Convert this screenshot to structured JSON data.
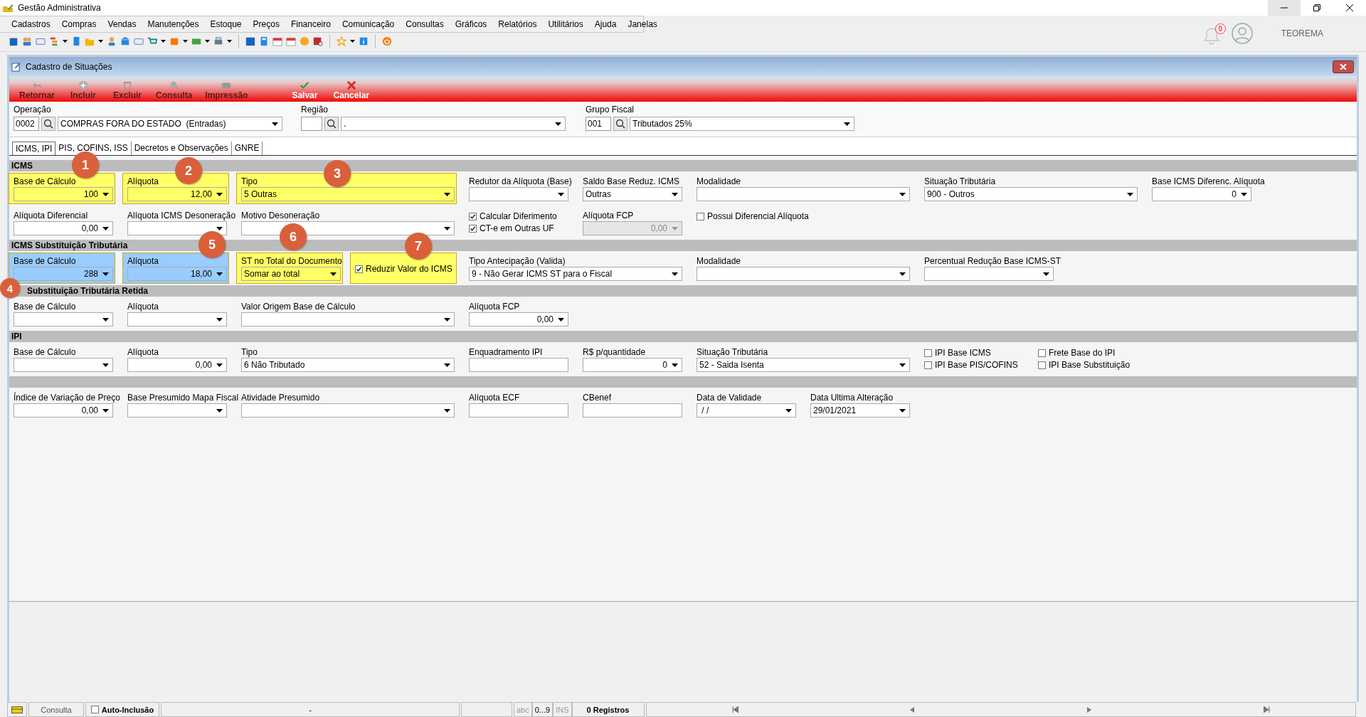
{
  "app": {
    "title": "Gestão Administrativa",
    "menu": [
      "Cadastros",
      "Compras",
      "Vendas",
      "Manutenções",
      "Estoque",
      "Preços",
      "Financeiro",
      "Comunicação",
      "Consultas",
      "Gráficos",
      "Relatórios",
      "Utilitários",
      "Ajuda",
      "Janelas"
    ],
    "notifications": "0",
    "user": "TEOREMA"
  },
  "window": {
    "title": "Cadastro de Situações",
    "actions": [
      {
        "label": "Retornar",
        "disabled": true
      },
      {
        "label": "Incluir",
        "disabled": true
      },
      {
        "label": "Excluir",
        "disabled": true
      },
      {
        "label": "Consulta",
        "disabled": true
      },
      {
        "label": "Impressão",
        "disabled": true
      },
      {
        "label": "Salvar",
        "disabled": false
      },
      {
        "label": "Cancelar",
        "disabled": false
      }
    ],
    "header_fields": [
      {
        "label": "Operação",
        "code": "0002",
        "value": "COMPRAS FORA DO ESTADO  (Entradas)"
      },
      {
        "label": "Região",
        "value": "."
      },
      {
        "label": "Grupo Fiscal",
        "code": "001",
        "value": "Tributados 25%"
      }
    ],
    "tabs": [
      {
        "label": "ICMS, IPI",
        "selected": true
      },
      {
        "label": "PIS, COFINS, ISS",
        "selected": false
      },
      {
        "label": "Decretos e Observações",
        "selected": false
      },
      {
        "label": "GNRE",
        "selected": false
      }
    ],
    "sections": [
      {
        "title": "ICMS",
        "rows": [
          [
            {
              "label": "Base de Cálculo",
              "kind": "number",
              "value": "100",
              "color": "#ffff66"
            },
            {
              "label": "Alíquota",
              "kind": "number",
              "value": "12,00",
              "color": "#ffff66"
            },
            {
              "label": "Tipo",
              "kind": "combo",
              "value": "5 Outras",
              "color": "#ffff66"
            },
            {
              "label": "Redutor da Alíquota (Base)",
              "kind": "combo"
            },
            {
              "label": "Saldo Base Reduz. ICMS",
              "kind": "combo",
              "value": "Outras"
            },
            {
              "label": "Modalidade",
              "kind": "combo"
            },
            {
              "label": "Situação Tributária",
              "kind": "combo",
              "value": "900 - Outros"
            },
            {
              "label": "Base ICMS Diferenc. Alíquota",
              "kind": "number",
              "value": "0"
            }
          ],
          [
            {
              "label": "Alíquota Diferencial",
              "kind": "number",
              "value": "0,00"
            },
            {
              "label": "Alíquota ICMS Desoneração",
              "kind": "combo"
            },
            {
              "label": "Motivo Desoneração",
              "kind": "combo"
            },
            {
              "kind": "checks",
              "items": [
                {
                  "label": "Calcular Diferimento",
                  "checked": true
                },
                {
                  "label": "CT-e em Outras UF",
                  "checked": true
                }
              ]
            },
            {
              "label": "Alíquota FCP",
              "kind": "number",
              "value": "0,00",
              "disabled": true
            },
            {
              "kind": "checks",
              "items": [
                {
                  "label": "Possui Diferencial Alíquota",
                  "checked": false
                }
              ]
            }
          ]
        ]
      },
      {
        "title": "ICMS Substituição Tributária",
        "rows": [
          [
            {
              "label": "Base de Cálculo",
              "kind": "number",
              "value": "288",
              "color": "#99ccff"
            },
            {
              "label": "Alíquota",
              "kind": "number",
              "value": "18,00",
              "color": "#99ccff"
            },
            {
              "label": "ST no Total do Documento",
              "kind": "combo",
              "value": "Somar ao total",
              "color": "#ffff66"
            },
            {
              "kind": "checks",
              "color": "#ffff66",
              "items": [
                {
                  "label": "Reduzir Valor do ICMS",
                  "checked": true
                }
              ]
            },
            {
              "label": "Tipo Antecipação (Valida)",
              "kind": "combo",
              "value": "9 - Não Gerar ICMS ST para o Fiscal"
            },
            {
              "label": "Modalidade",
              "kind": "combo"
            },
            {
              "label": "Percentual Redução Base ICMS-ST",
              "kind": "combo"
            }
          ]
        ]
      },
      {
        "title": "Substituição Tributária Retida",
        "rows": [
          [
            {
              "label": "Base de Cálculo",
              "kind": "combo"
            },
            {
              "label": "Alíquota",
              "kind": "combo"
            },
            {
              "label": "Valor Origem Base de Cálculo",
              "kind": "combo"
            },
            {
              "label": "Alíquota FCP",
              "kind": "number",
              "value": "0,00"
            }
          ]
        ]
      },
      {
        "title": "IPI",
        "rows": [
          [
            {
              "label": "Base de Cálculo",
              "kind": "combo"
            },
            {
              "label": "Alíquota",
              "kind": "number",
              "value": "0,00"
            },
            {
              "label": "Tipo",
              "kind": "combo",
              "value": "6 Não Tributado"
            },
            {
              "label": "Enquadramento IPI",
              "kind": "text"
            },
            {
              "label": "R$ p/quantidade",
              "kind": "number",
              "value": "0"
            },
            {
              "label": "Situação Tributária",
              "kind": "combo",
              "value": "52 - Saida Isenta"
            },
            {
              "kind": "checks",
              "items": [
                {
                  "label": "IPI Base ICMS",
                  "checked": false
                },
                {
                  "label": "IPI Base PIS/COFINS",
                  "checked": false
                }
              ]
            },
            {
              "kind": "checks",
              "items": [
                {
                  "label": "Frete Base do IPI",
                  "checked": false
                },
                {
                  "label": "IPI Base Substituição",
                  "checked": false
                }
              ]
            }
          ]
        ]
      },
      {
        "rows": [
          [
            {
              "label": "Índice de Variação de Preço",
              "kind": "number",
              "value": "0,00"
            },
            {
              "label": "Base Presumido Mapa Fiscal",
              "kind": "combo"
            },
            {
              "label": "Atividade Presumido",
              "kind": "combo"
            },
            {
              "label": "Alíquota ECF",
              "kind": "text"
            },
            {
              "label": "CBenef",
              "kind": "text"
            },
            {
              "label": "Data de Validade",
              "kind": "combo",
              "value": " / /"
            },
            {
              "label": "Data Ultima Alteração",
              "kind": "combo",
              "value": "29/01/2021"
            }
          ]
        ]
      }
    ]
  },
  "annotations": [
    {
      "label": "1"
    },
    {
      "label": "2"
    },
    {
      "label": "3"
    },
    {
      "label": "4"
    },
    {
      "label": "5"
    },
    {
      "label": "6"
    },
    {
      "label": "7"
    }
  ],
  "status_bar": {
    "mode": "Consulta",
    "auto_inclusion": {
      "label": "Auto-Inclusão",
      "checked": false
    },
    "center": "-",
    "indicators": [
      "abc",
      "0...9",
      "INS"
    ],
    "records": "0 Registros"
  }
}
